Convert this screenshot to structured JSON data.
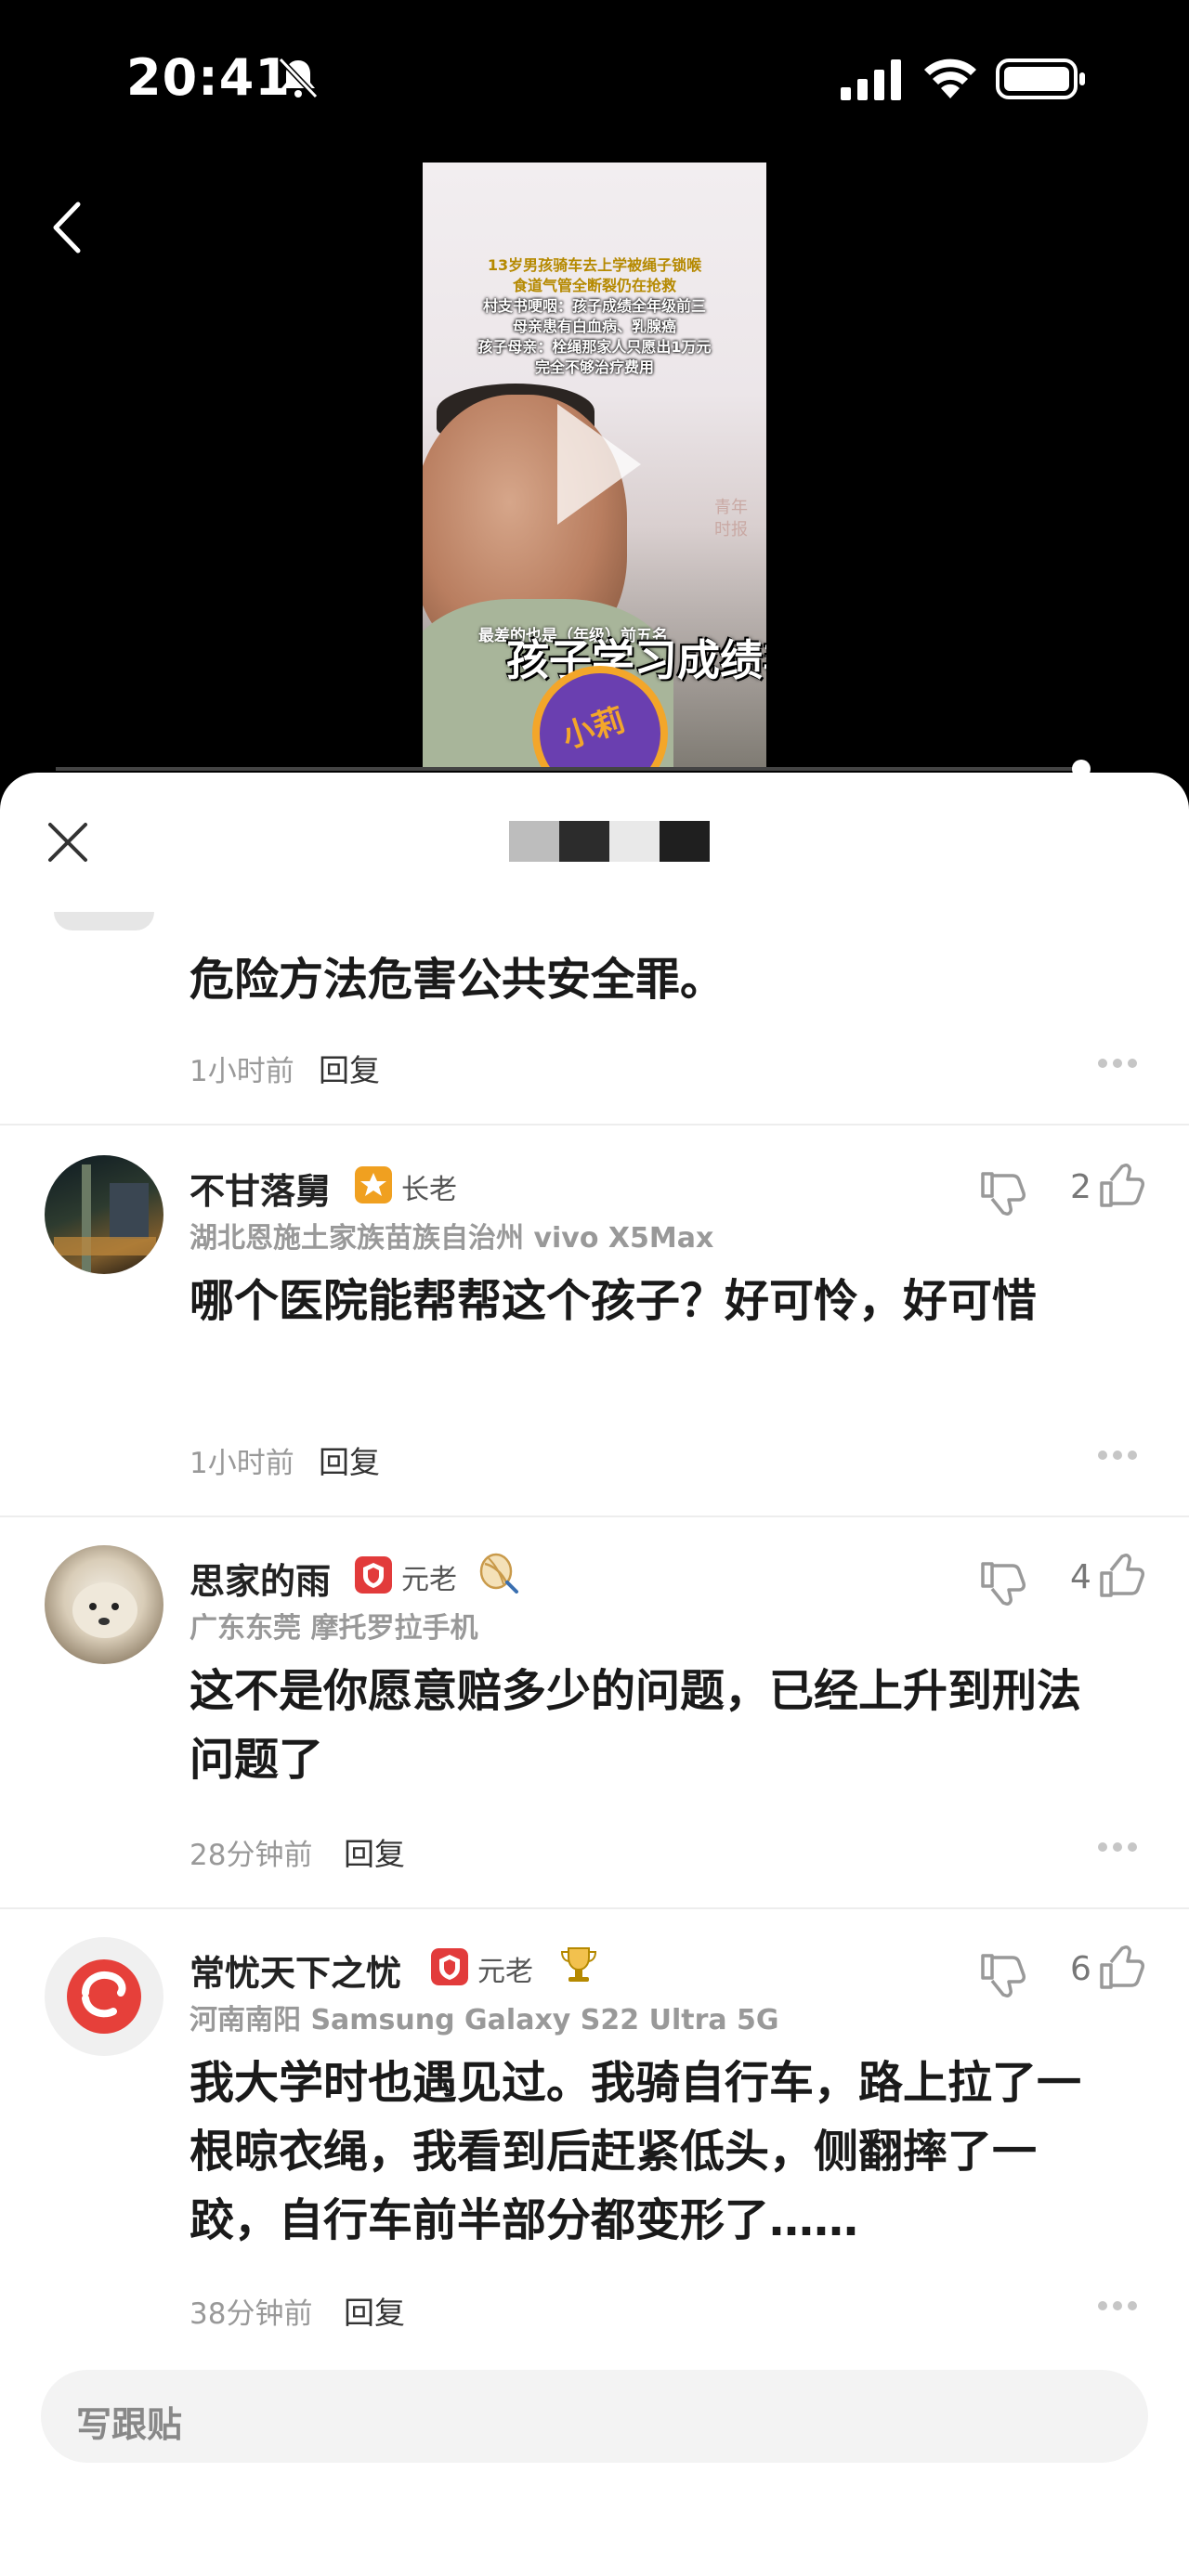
{
  "status_bar": {
    "time": "20:41"
  },
  "video": {
    "caption_lines": [
      {
        "text": "13岁男孩骑车去上学被绳子锁喉",
        "color": "yellow"
      },
      {
        "text": "食道气管全断裂仍在抢救",
        "color": "yellow"
      },
      {
        "text": "村支书哽咽：孩子成绩全年级前三",
        "color": "white"
      },
      {
        "text": "母亲患有白血病、乳腺癌",
        "color": "white"
      },
      {
        "text": "孩子母亲：栓绳那家人只愿出1万元",
        "color": "white"
      },
      {
        "text": "完全不够治疗费用",
        "color": "white"
      }
    ],
    "small_subtitle": "最差的也是（年级）前五名",
    "big_subtitle": "孩子学习成绩非常",
    "side_text": "青年时报",
    "badge_text": "小莉"
  },
  "comments": [
    {
      "content": "危险方法危害公共安全罪。",
      "time": "1小时前",
      "reply_label": "回复"
    },
    {
      "username": "不甘落舅",
      "level": "长老",
      "location": "湖北恩施土家族苗族自治州  vivo X5Max",
      "content": "哪个医院能帮帮这个孩子？好可怜，好可惜",
      "time": "1小时前",
      "reply_label": "回复",
      "likes": "2"
    },
    {
      "username": "思家的雨",
      "level": "元老",
      "location": "广东东莞  摩托罗拉手机",
      "content": "这不是你愿意赔多少的问题，已经上升到刑法问题了",
      "time": "28分钟前",
      "reply_label": "回复",
      "likes": "4"
    },
    {
      "username": "常忧天下之忧",
      "level": "元老",
      "location": "河南南阳  Samsung Galaxy S22 Ultra 5G",
      "content": "我大学时也遇见过。我骑自行车，路上拉了一根晾衣绳，我看到后赶紧低头，侧翻摔了一跤，自行车前半部分都变形了……",
      "time": "38分钟前",
      "reply_label": "回复",
      "likes": "6"
    }
  ],
  "followup": {
    "placeholder": "写跟贴"
  },
  "colors": {
    "badge_gold": "#f0a020",
    "badge_red": "#e23b3b",
    "text_dark": "#1a1a1a",
    "text_gray": "#999999"
  }
}
